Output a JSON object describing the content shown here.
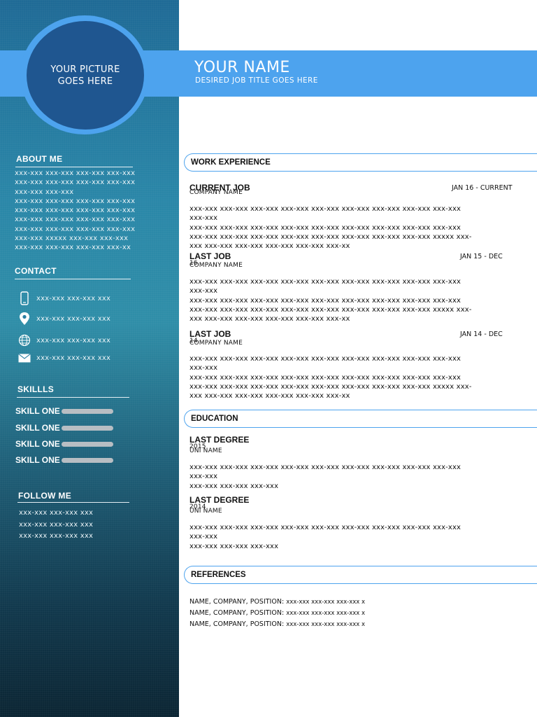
{
  "profile": {
    "photo_text": "YOUR PICTURE GOES HERE",
    "name": "YOUR NAME",
    "job_title": "DESIRED JOB TITLE GOES HERE"
  },
  "sidebar": {
    "about": {
      "heading": "ABOUT ME",
      "lines": [
        "xxx-xxx xxx-xxx xxx-xxx xxx-xxx",
        "xxx-xxx xxx-xxx xxx-xxx xxx-xxx",
        "xxx-xxx xxx-xxx",
        "xxx-xxx xxx-xxx xxx-xxx xxx-xxx",
        "xxx-xxx xxx-xxx xxx-xxx  xxx-xxx",
        "xxx-xxx xxx-xxx xxx-xxx xxx-xxx",
        "xxx-xxx xxx-xxx xxx-xxx xxx-xxx",
        "xxx-xxx xxxxx xxx-xxx  xxx-xxx",
        "xxx-xxx xxx-xxx xxx-xxx xxx-xx"
      ]
    },
    "contact": {
      "heading": "CONTACT",
      "items": [
        {
          "icon": "phone-icon",
          "text": "xxx-xxx xxx-xxx xxx"
        },
        {
          "icon": "location-pin-icon",
          "text": "xxx-xxx xxx-xxx xxx"
        },
        {
          "icon": "globe-icon",
          "text": "xxx-xxx xxx-xxx xxx"
        },
        {
          "icon": "envelope-icon",
          "text": "xxx-xxx xxx-xxx xxx"
        }
      ]
    },
    "skills": {
      "heading": "SKILLLS",
      "items": [
        {
          "label": "SKILL ONE",
          "level": 1.0
        },
        {
          "label": "SKILL ONE",
          "level": 1.0
        },
        {
          "label": "SKILL ONE",
          "level": 1.0
        },
        {
          "label": "SKILL ONE",
          "level": 1.0
        }
      ]
    },
    "follow": {
      "heading": "FOLLOW ME",
      "lines": [
        "xxx-xxx xxx-xxx xxx",
        "xxx-xxx xxx-xxx xxx",
        "xxx-xxx xxx-xxx xxx"
      ]
    }
  },
  "work": {
    "heading": "WORK EXPERIENCE",
    "jobs": [
      {
        "title": "CURRENT JOB",
        "company": "COMPANY NAME",
        "date": "JAN 16 - CURRENT",
        "lines": [
          "xxx-xxx xxx-xxx xxx-xxx xxx-xxx xxx-xxx xxx-xxx xxx-xxx xxx-xxx xxx-xxx",
          "xxx-xxx",
          "xxx-xxx xxx-xxx xxx-xxx xxx-xxx xxx-xxx xxx-xxx xxx-xxx  xxx-xxx xxx-xxx",
          "xxx-xxx xxx-xxx xxx-xxx xxx-xxx xxx-xxx xxx-xxx xxx-xxx xxx-xxx xxxxx xxx-",
          "xxx  xxx-xxx xxx-xxx xxx-xxx xxx-xxx xxx-xx"
        ]
      },
      {
        "title": "LAST JOB",
        "company": "COMPANY NAME",
        "date": "JAN 15 - DEC",
        "year": "16",
        "lines": [
          "xxx-xxx xxx-xxx xxx-xxx xxx-xxx xxx-xxx xxx-xxx xxx-xxx xxx-xxx xxx-xxx",
          "xxx-xxx",
          "xxx-xxx xxx-xxx xxx-xxx xxx-xxx xxx-xxx xxx-xxx xxx-xxx  xxx-xxx xxx-xxx",
          "xxx-xxx xxx-xxx xxx-xxx xxx-xxx xxx-xxx xxx-xxx xxx-xxx xxx-xxx xxxxx xxx-",
          "xxx  xxx-xxx xxx-xxx xxx-xxx xxx-xxx xxx-xx"
        ]
      },
      {
        "title": "LAST JOB",
        "company": "COMPANY NAME",
        "date": "JAN 14 - DEC",
        "year": "14",
        "lines": [
          "xxx-xxx xxx-xxx xxx-xxx xxx-xxx xxx-xxx xxx-xxx xxx-xxx xxx-xxx xxx-xxx",
          "xxx-xxx",
          "xxx-xxx xxx-xxx xxx-xxx xxx-xxx xxx-xxx xxx-xxx xxx-xxx  xxx-xxx xxx-xxx",
          "xxx-xxx xxx-xxx xxx-xxx xxx-xxx xxx-xxx xxx-xxx xxx-xxx xxx-xxx xxxxx xxx-",
          "xxx  xxx-xxx xxx-xxx xxx-xxx xxx-xxx xxx-xx"
        ]
      }
    ]
  },
  "education": {
    "heading": "EDUCATION",
    "degrees": [
      {
        "title": "LAST DEGREE",
        "year": "2015",
        "school": "UNI NAME",
        "lines": [
          "xxx-xxx xxx-xxx xxx-xxx xxx-xxx xxx-xxx xxx-xxx xxx-xxx xxx-xxx xxx-xxx",
          "xxx-xxx",
          "xxx-xxx xxx-xxx xxx-xxx"
        ]
      },
      {
        "title": "LAST DEGREE",
        "year": "2014",
        "school": "UNI NAME",
        "lines": [
          "xxx-xxx xxx-xxx xxx-xxx xxx-xxx xxx-xxx xxx-xxx xxx-xxx xxx-xxx xxx-xxx",
          "xxx-xxx",
          "xxx-xxx xxx-xxx xxx-xxx"
        ]
      }
    ]
  },
  "references": {
    "heading": "REFERENCES",
    "items": [
      {
        "label": "NAME, COMPANY, POSITION:",
        "value": "xxx-xxx xxx-xxx xxx-xxx x"
      },
      {
        "label": "NAME, COMPANY, POSITION:",
        "value": "xxx-xxx xxx-xxx xxx-xxx x"
      },
      {
        "label": "NAME, COMPANY, POSITION:",
        "value": "xxx-xxx xxx-xxx xxx-xxx x"
      }
    ]
  },
  "colors": {
    "accent": "#4da3ee",
    "photo_fill": "#1f5690",
    "sidebar_top": "#1f6a96",
    "sidebar_bottom": "#0b2533",
    "skill_bar": "#b8bec3"
  }
}
